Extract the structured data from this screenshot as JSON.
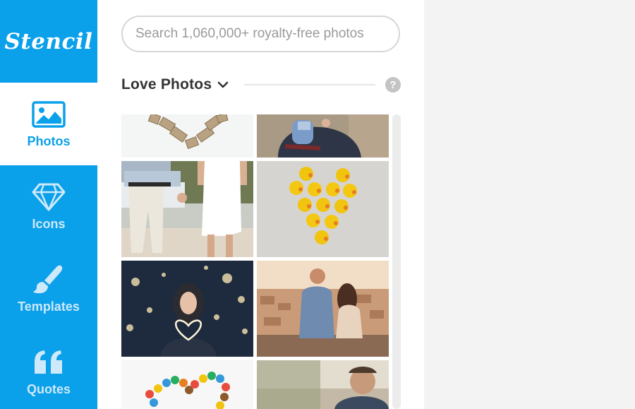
{
  "app": {
    "logo_text": "Stencil"
  },
  "nav": {
    "items": [
      {
        "label": "Photos",
        "icon": "image-icon",
        "active": true
      },
      {
        "label": "Icons",
        "icon": "diamond-icon",
        "active": false
      },
      {
        "label": "Templates",
        "icon": "brush-icon",
        "active": false
      },
      {
        "label": "Quotes",
        "icon": "quote-icon",
        "active": false
      }
    ]
  },
  "search": {
    "placeholder": "Search 1,060,000+ royalty-free photos"
  },
  "section": {
    "title": "Love Photos",
    "help_glyph": "?"
  },
  "photos": [
    {
      "subject": "wooden-heart"
    },
    {
      "subject": "couple-hug"
    },
    {
      "subject": "couple-walking"
    },
    {
      "subject": "rubber-ducks-heart"
    },
    {
      "subject": "woman-sparkler-heart"
    },
    {
      "subject": "couple-overlook-city"
    },
    {
      "subject": "candy-heart"
    },
    {
      "subject": "couple-sunset"
    }
  ],
  "colors": {
    "accent": "#0aa0ea",
    "nav_inactive_text": "#cde9fa",
    "panel_bg": "#ffffff",
    "page_bg": "#f3f3f3"
  }
}
